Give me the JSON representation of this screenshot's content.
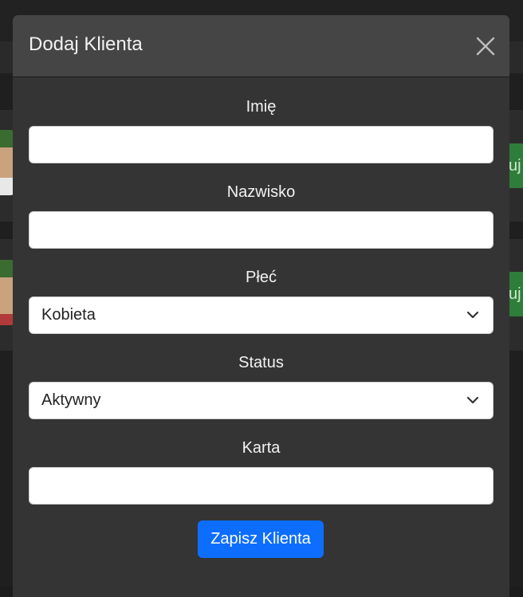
{
  "modal": {
    "title": "Dodaj Klienta",
    "close_icon": "close-icon"
  },
  "form": {
    "first_name": {
      "label": "Imię",
      "value": ""
    },
    "last_name": {
      "label": "Nazwisko",
      "value": ""
    },
    "gender": {
      "label": "Płeć",
      "selected": "Kobieta",
      "icon": "chevron-down-icon"
    },
    "status": {
      "label": "Status",
      "selected": "Aktywny",
      "icon": "chevron-down-icon"
    },
    "card": {
      "label": "Karta",
      "value": ""
    },
    "submit_label": "Zapisz Klienta"
  },
  "background": {
    "row_button_fragment": "uj"
  },
  "colors": {
    "primary_button": "#0d6efd",
    "modal_body": "#343434",
    "modal_header": "#454545",
    "bg_action_button": "#2f7d3a"
  }
}
